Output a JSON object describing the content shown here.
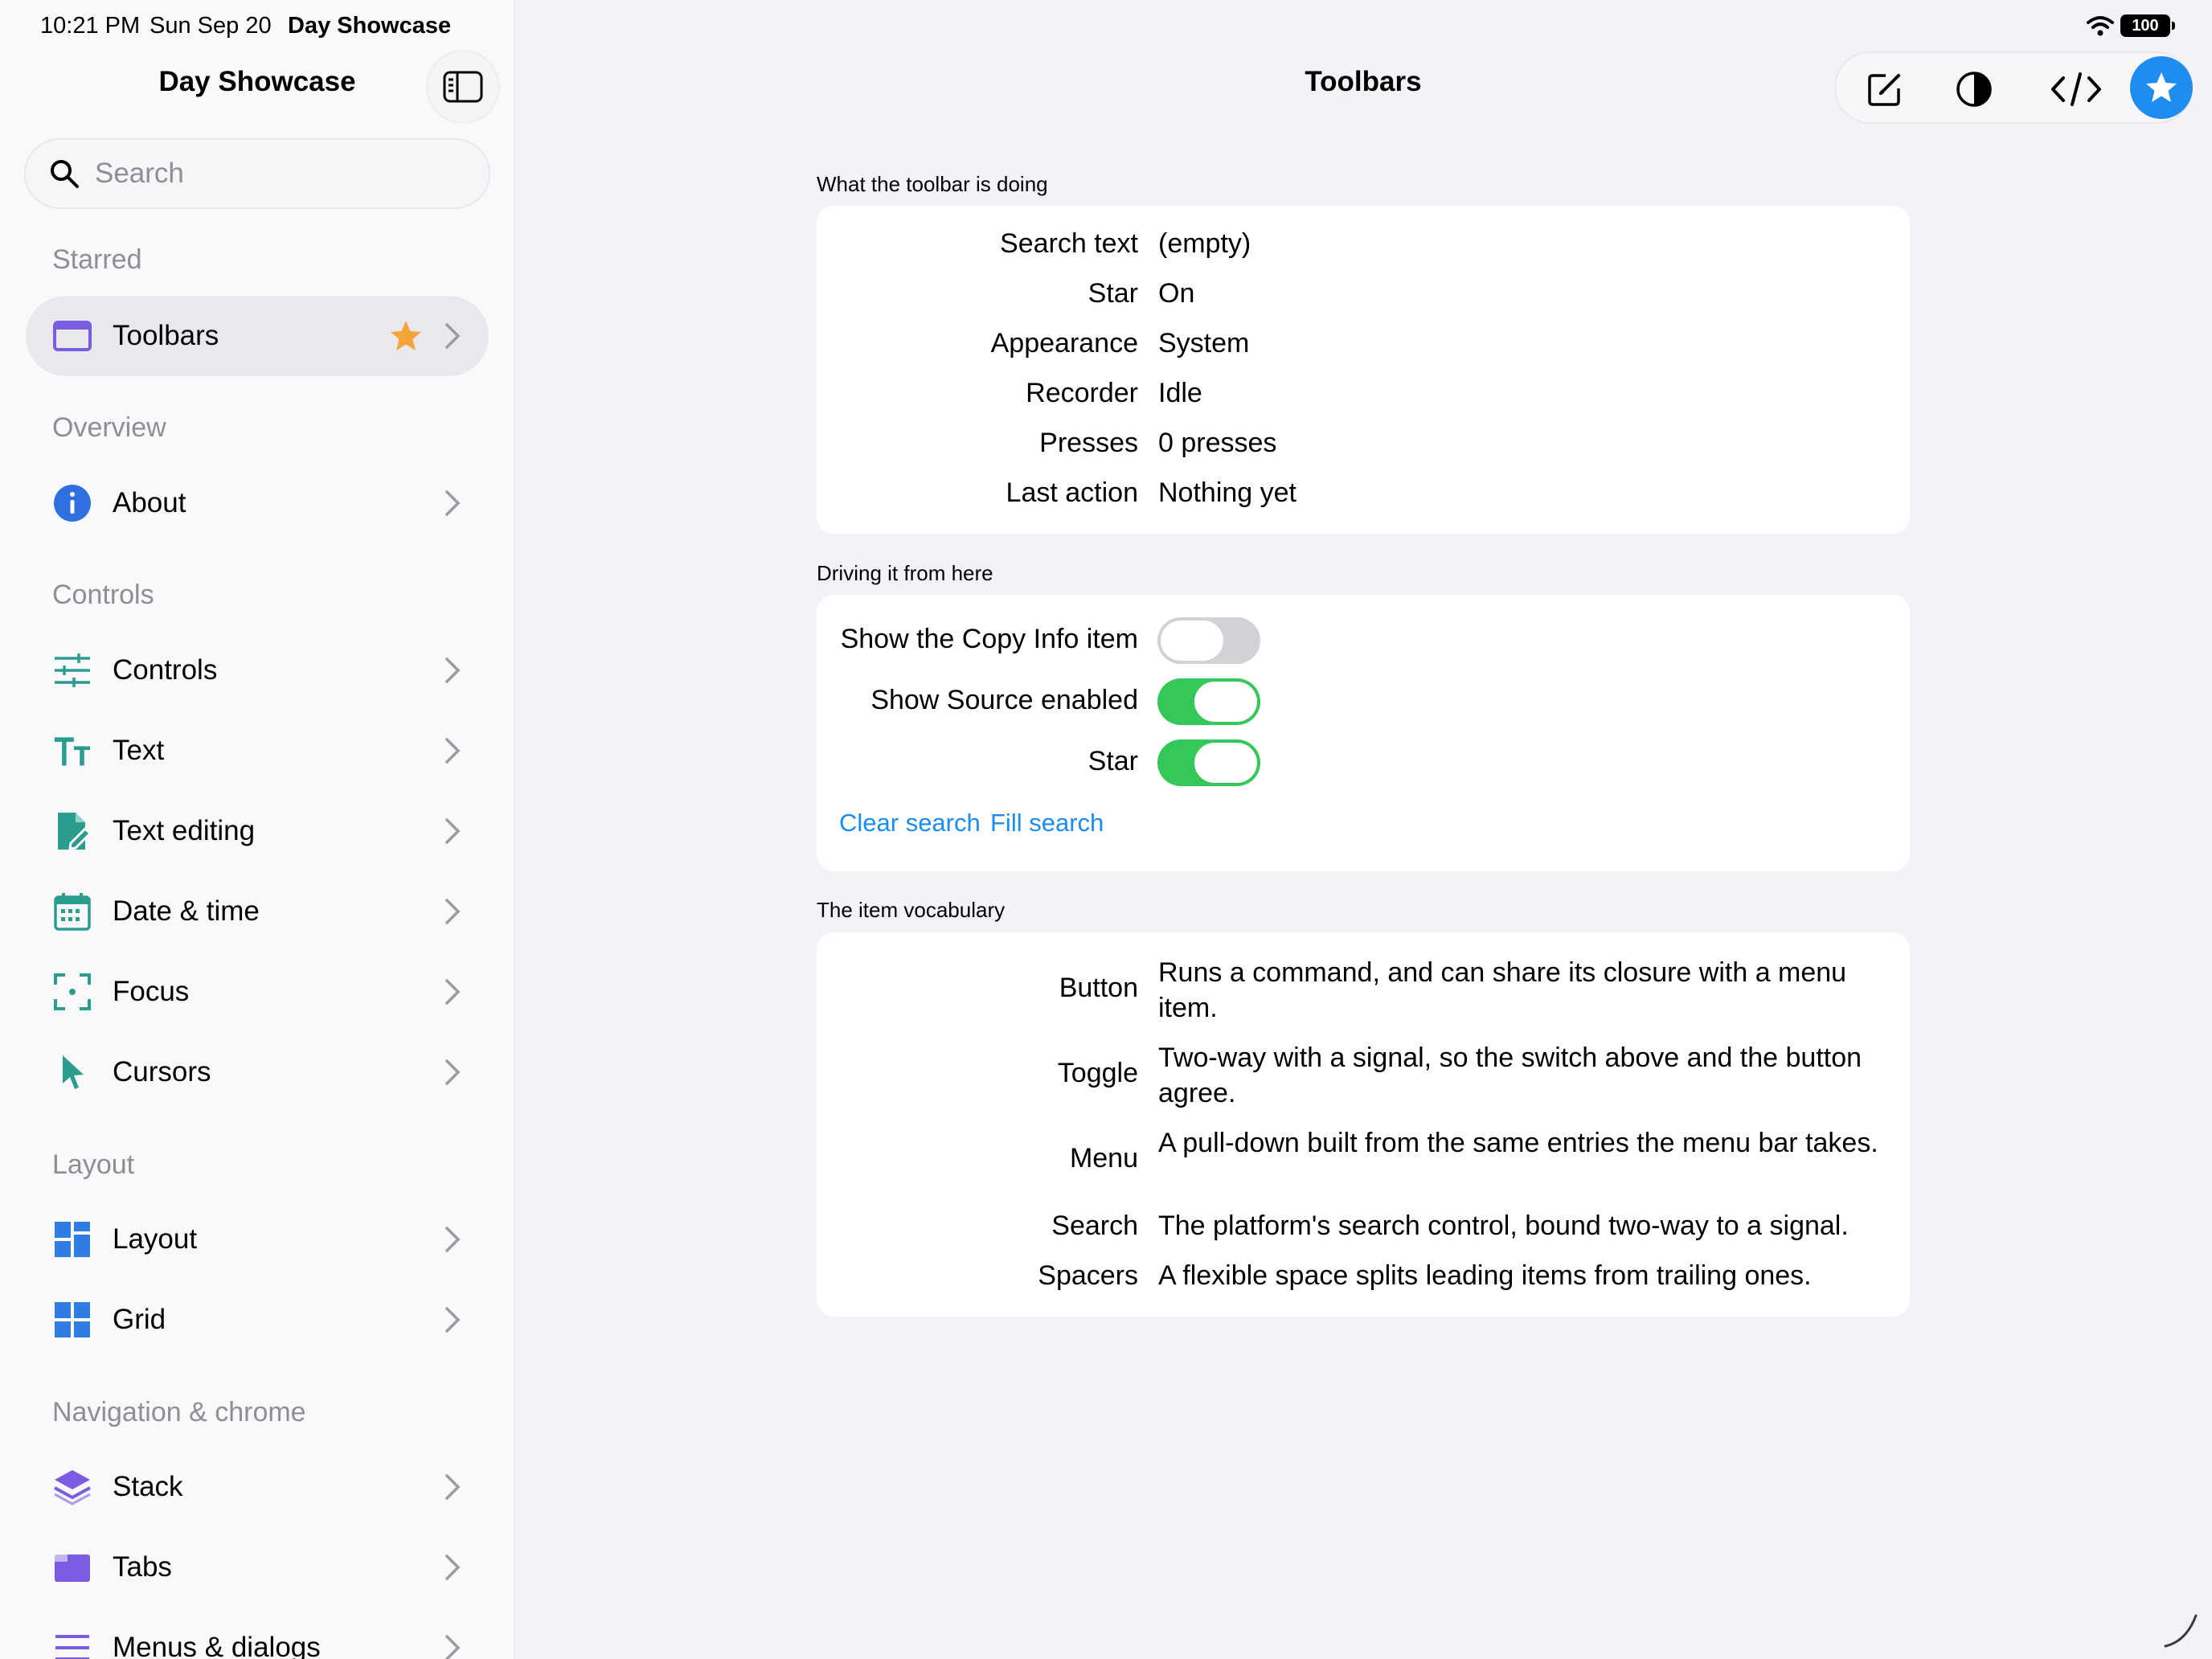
{
  "status_bar": {
    "time": "10:21 PM",
    "date": "Sun Sep 20",
    "app": "Day Showcase",
    "battery": "100"
  },
  "sidebar": {
    "title": "Day Showcase",
    "search_placeholder": "Search",
    "sections": [
      {
        "header": "Starred",
        "items": [
          {
            "label": "Toolbars",
            "icon": "window-icon",
            "starred": true
          }
        ]
      },
      {
        "header": "Overview",
        "items": [
          {
            "label": "About",
            "icon": "info-icon"
          }
        ]
      },
      {
        "header": "Controls",
        "items": [
          {
            "label": "Controls",
            "icon": "sliders-icon"
          },
          {
            "label": "Text",
            "icon": "text-size-icon"
          },
          {
            "label": "Text editing",
            "icon": "document-edit-icon"
          },
          {
            "label": "Date & time",
            "icon": "calendar-icon"
          },
          {
            "label": "Focus",
            "icon": "focus-icon"
          },
          {
            "label": "Cursors",
            "icon": "cursor-icon"
          }
        ]
      },
      {
        "header": "Layout",
        "items": [
          {
            "label": "Layout",
            "icon": "layout-icon"
          },
          {
            "label": "Grid",
            "icon": "grid-icon"
          }
        ]
      },
      {
        "header": "Navigation & chrome",
        "items": [
          {
            "label": "Stack",
            "icon": "stack-icon"
          },
          {
            "label": "Tabs",
            "icon": "tabs-icon"
          },
          {
            "label": "Menus & dialogs",
            "icon": "menu-icon"
          }
        ]
      }
    ]
  },
  "main": {
    "title": "Toolbars",
    "toolbar": {
      "items": [
        "compose-icon",
        "appearance-icon",
        "source-code-icon",
        "star-icon"
      ]
    },
    "groups": {
      "status": {
        "label": "What the toolbar is doing",
        "rows": [
          {
            "key": "Search text",
            "value": "(empty)"
          },
          {
            "key": "Star",
            "value": "On"
          },
          {
            "key": "Appearance",
            "value": "System"
          },
          {
            "key": "Recorder",
            "value": "Idle"
          },
          {
            "key": "Presses",
            "value": "0 presses"
          },
          {
            "key": "Last action",
            "value": "Nothing yet"
          }
        ]
      },
      "driving": {
        "label": "Driving it from here",
        "toggles": [
          {
            "label": "Show the Copy Info item",
            "on": false
          },
          {
            "label": "Show Source enabled",
            "on": true
          },
          {
            "label": "Star",
            "on": true
          }
        ],
        "links": [
          "Clear search",
          "Fill search"
        ]
      },
      "vocabulary": {
        "label": "The item vocabulary",
        "rows": [
          {
            "key": "Button",
            "value": "Runs a command, and can share its closure with a menu item."
          },
          {
            "key": "Toggle",
            "value": "Two-way with a signal, so the switch above and the button agree."
          },
          {
            "key": "Menu",
            "value": "A pull-down built from the same entries the menu bar takes."
          },
          {
            "key": "Search",
            "value": "The platform's search control, bound two-way to a signal."
          },
          {
            "key": "Spacers",
            "value": "A flexible space splits leading items from trailing ones."
          }
        ]
      }
    }
  },
  "colors": {
    "accent": "#1f8cf0",
    "toggle_on": "#34c759",
    "star": "#f3a43a",
    "teal_icon": "#2a9d8f",
    "purple_icon": "#7a5ce0",
    "blue_icon": "#2f7de1"
  }
}
